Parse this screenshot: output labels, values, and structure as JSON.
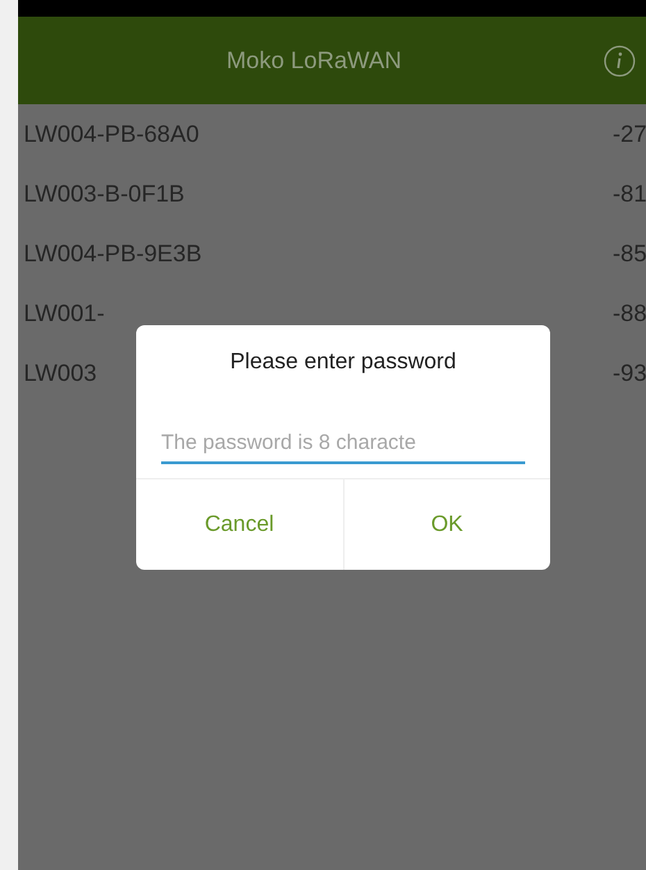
{
  "header": {
    "title": "Moko LoRaWAN"
  },
  "devices": [
    {
      "name": "LW004-PB-68A0",
      "rssi": "-27"
    },
    {
      "name": "LW003-B-0F1B",
      "rssi": "-81"
    },
    {
      "name": "LW004-PB-9E3B",
      "rssi": "-85"
    },
    {
      "name": "LW001-",
      "rssi": "-88"
    },
    {
      "name": "LW003",
      "rssi": "-93"
    }
  ],
  "dialog": {
    "title": "Please enter password",
    "placeholder": "The password is 8 characte",
    "buttons": [
      "Cancel",
      "OK"
    ]
  }
}
